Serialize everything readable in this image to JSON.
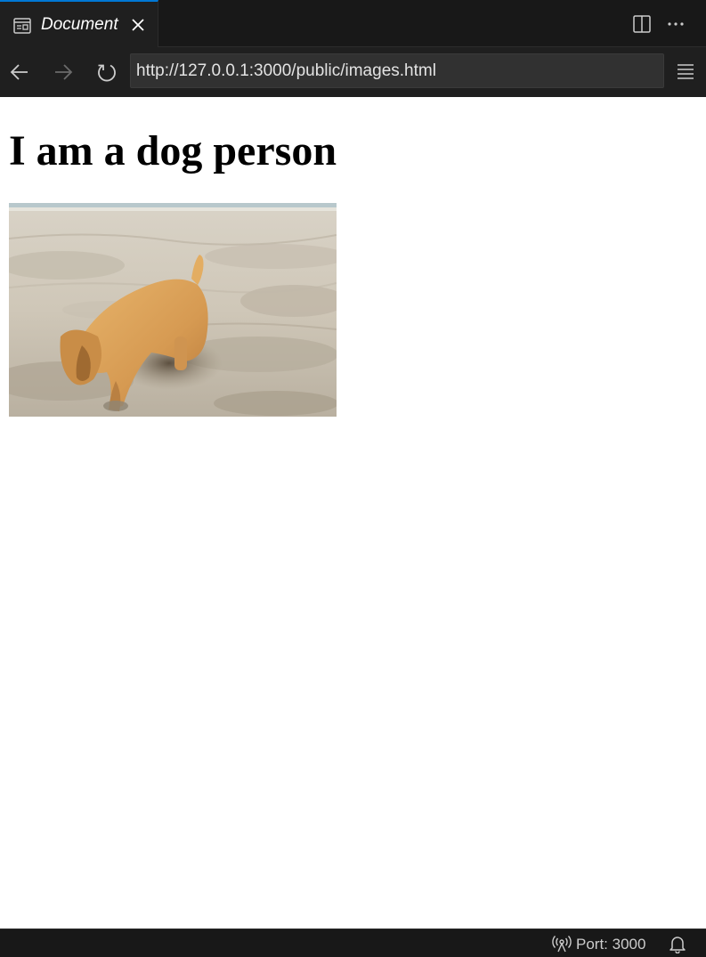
{
  "tab": {
    "title": "Document",
    "icon": "preview-icon",
    "close_icon": "close-icon",
    "active_border_color": "#0078d4"
  },
  "toolbar": {
    "split_icon": "split-editor-icon",
    "more_icon": "more-actions-icon"
  },
  "nav": {
    "back_icon": "arrow-left-icon",
    "forward_icon": "arrow-right-icon",
    "reload_icon": "reload-icon",
    "url": "http://127.0.0.1:3000/public/images.html",
    "menu_icon": "hamburger-menu-icon"
  },
  "page": {
    "heading": "I am a dog person",
    "image_subject": "puppy digging in beach sand"
  },
  "status": {
    "port_label": "Port: 3000",
    "port_icon": "broadcast-icon",
    "bell_icon": "bell-icon"
  }
}
